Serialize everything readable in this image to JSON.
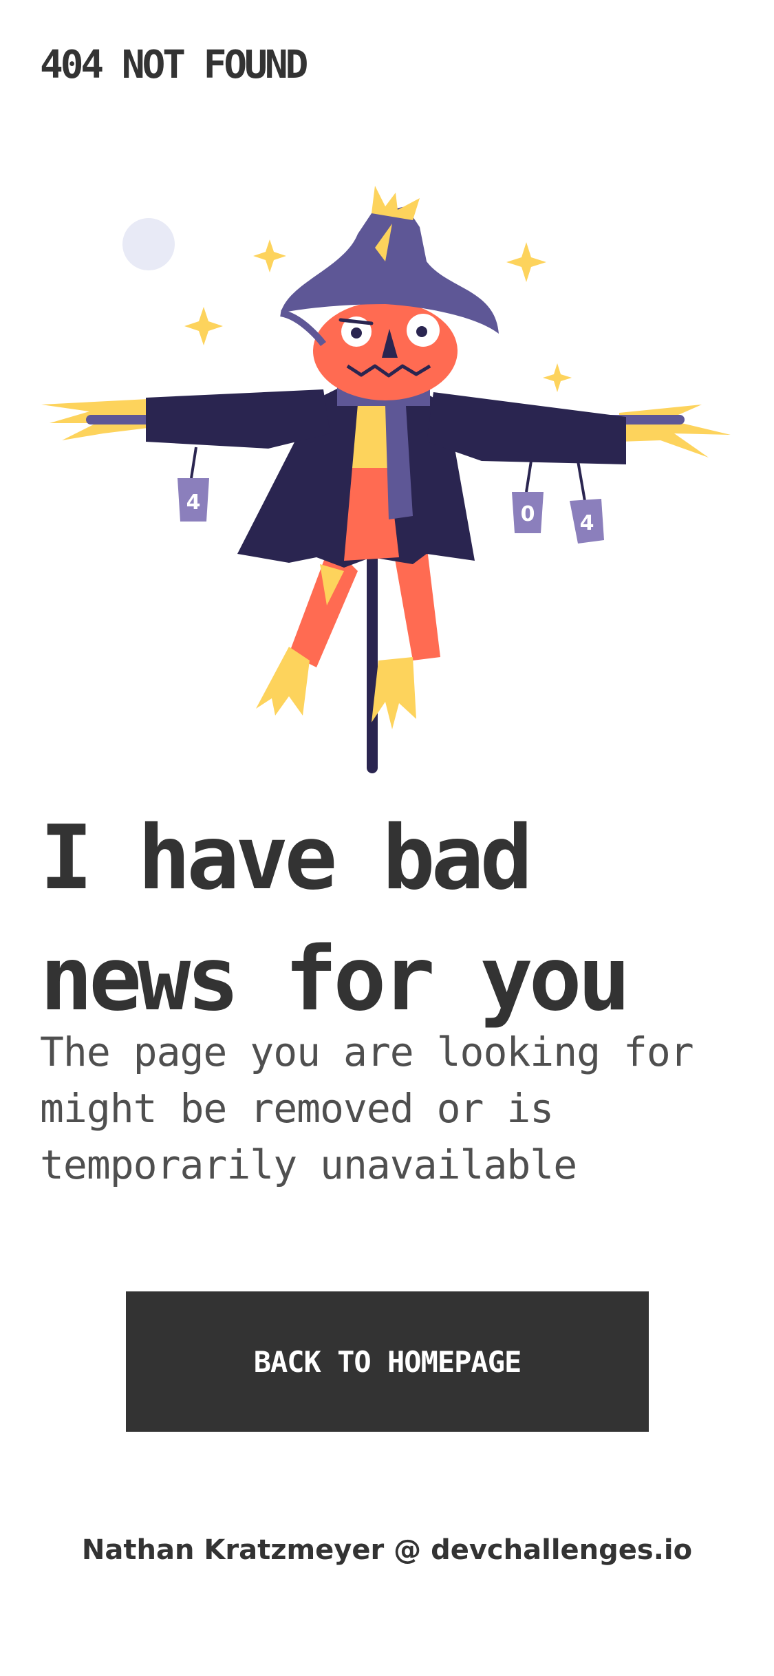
{
  "header": {
    "brand_label": "404 NOT FOUND"
  },
  "illustration": {
    "icon": "scarecrow-illustration",
    "cans": [
      "4",
      "0",
      "4"
    ],
    "colors": {
      "hat": "#5E5796",
      "coat": "#2A2550",
      "face": "#FF6B52",
      "straw": "#FDD35C",
      "moon": "#E8EAF6"
    }
  },
  "main": {
    "headline_line1": "I have bad",
    "headline_line2": "news for you",
    "subtext_line1": "The page you are looking for",
    "subtext_line2": "might be removed or is",
    "subtext_line3": "temporarily unavailable",
    "cta_label": "BACK TO HOMEPAGE"
  },
  "footer": {
    "author": "Nathan Kratzmeyer",
    "separator": "@",
    "site": "devchallenges.io"
  },
  "theme": {
    "text": "#333333",
    "muted_text": "#4F4F4F",
    "button_bg": "#333333",
    "button_text": "#FFFFFF"
  }
}
